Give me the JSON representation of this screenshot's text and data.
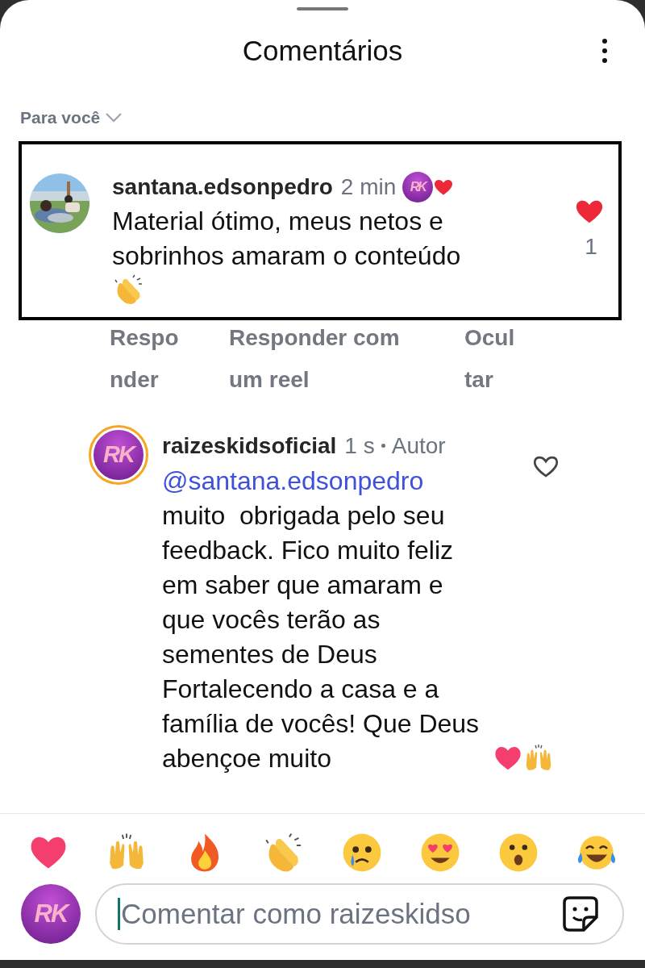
{
  "header": {
    "title": "Comentários"
  },
  "filter": {
    "label": "Para você"
  },
  "comment": {
    "highlighted": true,
    "username": "santana.edsonpedro",
    "time": "2 min",
    "author_like_initials": "RK",
    "text": "Material ótimo, meus netos e sobrinhos amaram o conteúdo",
    "liked": true,
    "like_count": "1",
    "actions": [
      "Responder",
      "Responder com um reel",
      "Ocultar"
    ]
  },
  "reply": {
    "username": "raizeskidsoficial",
    "avatar_initials": "RK",
    "time": "1 s",
    "author_label": "Autor",
    "mention": "@santana.edsonpedro",
    "text": "muito  obrigada pelo seu feedback. Fico muito feliz em saber que amaram e que vocês terão as sementes de Deus Fortalecendo a casa e a família de vocês! Que Deus abençoe muito",
    "liked": false
  },
  "composer": {
    "avatar_initials": "RK",
    "placeholder": "Comentar como raizeskidso"
  }
}
